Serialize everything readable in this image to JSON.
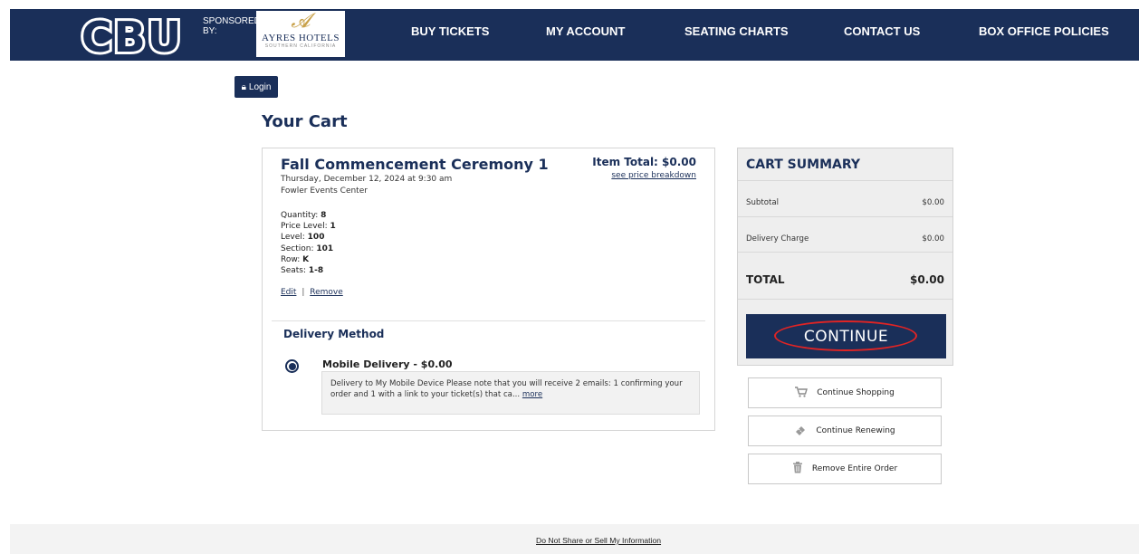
{
  "header": {
    "logo_text": "CBU",
    "sponsored_label": "SPONSORED BY:",
    "sponsor": {
      "name": "AYRES HOTELS",
      "sub": "SOUTHERN CALIFORNIA"
    },
    "nav": [
      "BUY TICKETS",
      "MY ACCOUNT",
      "SEATING CHARTS",
      "CONTACT US",
      "BOX OFFICE POLICIES"
    ]
  },
  "login": {
    "label": "Login",
    "icon": "lock-icon"
  },
  "page_title": "Your Cart",
  "item": {
    "title": "Fall Commencement Ceremony 1",
    "date": "Thursday, December 12, 2024 at 9:30 am",
    "venue": "Fowler Events Center",
    "item_total": "Item Total: $0.00",
    "price_breakdown_link": "see price breakdown",
    "details": [
      {
        "label": "Quantity:",
        "value": "8"
      },
      {
        "label": "Price Level:",
        "value": "1"
      },
      {
        "label": "Level:",
        "value": "100"
      },
      {
        "label": "Section:",
        "value": "101"
      },
      {
        "label": "Row:",
        "value": "K"
      },
      {
        "label": "Seats:",
        "value": "1-8"
      }
    ],
    "edit_link": "Edit",
    "separator": "|",
    "remove_link": "Remove"
  },
  "delivery": {
    "heading": "Delivery Method",
    "option_label": "Mobile Delivery - $0.00",
    "note": "Delivery to My Mobile Device Please note that you will receive 2 emails: 1 confirming your order and 1 with a link to your ticket(s) that ca...",
    "more_link": "more"
  },
  "summary": {
    "title": "CART SUMMARY",
    "subtotal_label": "Subtotal",
    "subtotal_value": "$0.00",
    "delivery_label": "Delivery Charge",
    "delivery_value": "$0.00",
    "total_label": "TOTAL",
    "total_value": "$0.00",
    "continue_label": "CONTINUE"
  },
  "actions": [
    {
      "label": "Continue Shopping",
      "icon": "cart-icon"
    },
    {
      "label": "Continue Renewing",
      "icon": "ticket-icon"
    },
    {
      "label": "Remove Entire Order",
      "icon": "trash-icon"
    }
  ],
  "footer": {
    "link": "Do Not Share or Sell My Information"
  },
  "colors": {
    "navy": "#1a2f59",
    "highlight": "#e02424"
  }
}
